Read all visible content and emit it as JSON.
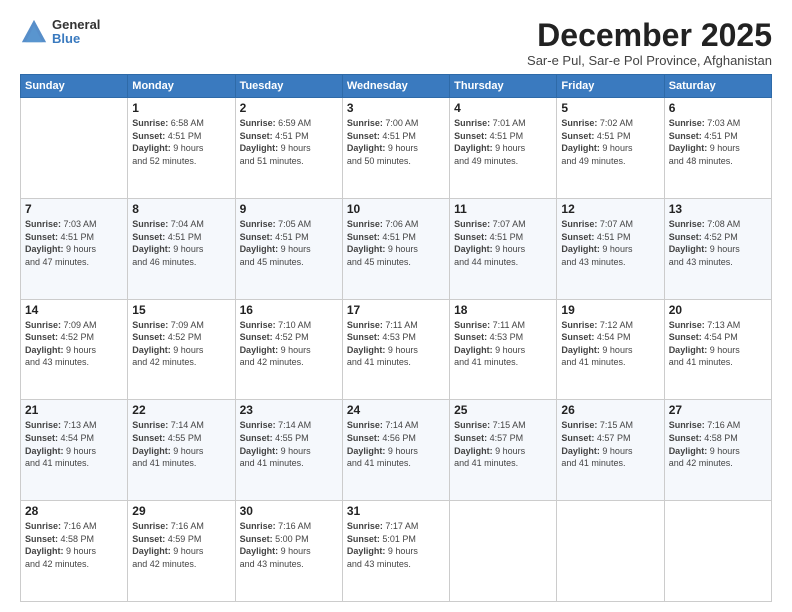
{
  "logo": {
    "general": "General",
    "blue": "Blue"
  },
  "header": {
    "month": "December 2025",
    "subtitle": "Sar-e Pul, Sar-e Pol Province, Afghanistan"
  },
  "weekdays": [
    "Sunday",
    "Monday",
    "Tuesday",
    "Wednesday",
    "Thursday",
    "Friday",
    "Saturday"
  ],
  "weeks": [
    [
      {
        "day": "",
        "info": ""
      },
      {
        "day": "1",
        "info": "Sunrise: 6:58 AM\nSunset: 4:51 PM\nDaylight: 9 hours\nand 52 minutes."
      },
      {
        "day": "2",
        "info": "Sunrise: 6:59 AM\nSunset: 4:51 PM\nDaylight: 9 hours\nand 51 minutes."
      },
      {
        "day": "3",
        "info": "Sunrise: 7:00 AM\nSunset: 4:51 PM\nDaylight: 9 hours\nand 50 minutes."
      },
      {
        "day": "4",
        "info": "Sunrise: 7:01 AM\nSunset: 4:51 PM\nDaylight: 9 hours\nand 49 minutes."
      },
      {
        "day": "5",
        "info": "Sunrise: 7:02 AM\nSunset: 4:51 PM\nDaylight: 9 hours\nand 49 minutes."
      },
      {
        "day": "6",
        "info": "Sunrise: 7:03 AM\nSunset: 4:51 PM\nDaylight: 9 hours\nand 48 minutes."
      }
    ],
    [
      {
        "day": "7",
        "info": "Sunrise: 7:03 AM\nSunset: 4:51 PM\nDaylight: 9 hours\nand 47 minutes."
      },
      {
        "day": "8",
        "info": "Sunrise: 7:04 AM\nSunset: 4:51 PM\nDaylight: 9 hours\nand 46 minutes."
      },
      {
        "day": "9",
        "info": "Sunrise: 7:05 AM\nSunset: 4:51 PM\nDaylight: 9 hours\nand 45 minutes."
      },
      {
        "day": "10",
        "info": "Sunrise: 7:06 AM\nSunset: 4:51 PM\nDaylight: 9 hours\nand 45 minutes."
      },
      {
        "day": "11",
        "info": "Sunrise: 7:07 AM\nSunset: 4:51 PM\nDaylight: 9 hours\nand 44 minutes."
      },
      {
        "day": "12",
        "info": "Sunrise: 7:07 AM\nSunset: 4:51 PM\nDaylight: 9 hours\nand 43 minutes."
      },
      {
        "day": "13",
        "info": "Sunrise: 7:08 AM\nSunset: 4:52 PM\nDaylight: 9 hours\nand 43 minutes."
      }
    ],
    [
      {
        "day": "14",
        "info": "Sunrise: 7:09 AM\nSunset: 4:52 PM\nDaylight: 9 hours\nand 43 minutes."
      },
      {
        "day": "15",
        "info": "Sunrise: 7:09 AM\nSunset: 4:52 PM\nDaylight: 9 hours\nand 42 minutes."
      },
      {
        "day": "16",
        "info": "Sunrise: 7:10 AM\nSunset: 4:52 PM\nDaylight: 9 hours\nand 42 minutes."
      },
      {
        "day": "17",
        "info": "Sunrise: 7:11 AM\nSunset: 4:53 PM\nDaylight: 9 hours\nand 41 minutes."
      },
      {
        "day": "18",
        "info": "Sunrise: 7:11 AM\nSunset: 4:53 PM\nDaylight: 9 hours\nand 41 minutes."
      },
      {
        "day": "19",
        "info": "Sunrise: 7:12 AM\nSunset: 4:54 PM\nDaylight: 9 hours\nand 41 minutes."
      },
      {
        "day": "20",
        "info": "Sunrise: 7:13 AM\nSunset: 4:54 PM\nDaylight: 9 hours\nand 41 minutes."
      }
    ],
    [
      {
        "day": "21",
        "info": "Sunrise: 7:13 AM\nSunset: 4:54 PM\nDaylight: 9 hours\nand 41 minutes."
      },
      {
        "day": "22",
        "info": "Sunrise: 7:14 AM\nSunset: 4:55 PM\nDaylight: 9 hours\nand 41 minutes."
      },
      {
        "day": "23",
        "info": "Sunrise: 7:14 AM\nSunset: 4:55 PM\nDaylight: 9 hours\nand 41 minutes."
      },
      {
        "day": "24",
        "info": "Sunrise: 7:14 AM\nSunset: 4:56 PM\nDaylight: 9 hours\nand 41 minutes."
      },
      {
        "day": "25",
        "info": "Sunrise: 7:15 AM\nSunset: 4:57 PM\nDaylight: 9 hours\nand 41 minutes."
      },
      {
        "day": "26",
        "info": "Sunrise: 7:15 AM\nSunset: 4:57 PM\nDaylight: 9 hours\nand 41 minutes."
      },
      {
        "day": "27",
        "info": "Sunrise: 7:16 AM\nSunset: 4:58 PM\nDaylight: 9 hours\nand 42 minutes."
      }
    ],
    [
      {
        "day": "28",
        "info": "Sunrise: 7:16 AM\nSunset: 4:58 PM\nDaylight: 9 hours\nand 42 minutes."
      },
      {
        "day": "29",
        "info": "Sunrise: 7:16 AM\nSunset: 4:59 PM\nDaylight: 9 hours\nand 42 minutes."
      },
      {
        "day": "30",
        "info": "Sunrise: 7:16 AM\nSunset: 5:00 PM\nDaylight: 9 hours\nand 43 minutes."
      },
      {
        "day": "31",
        "info": "Sunrise: 7:17 AM\nSunset: 5:01 PM\nDaylight: 9 hours\nand 43 minutes."
      },
      {
        "day": "",
        "info": ""
      },
      {
        "day": "",
        "info": ""
      },
      {
        "day": "",
        "info": ""
      }
    ]
  ]
}
